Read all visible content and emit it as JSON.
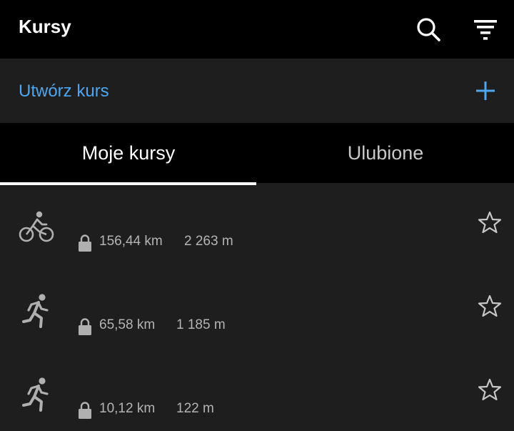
{
  "header": {
    "title": "Kursy",
    "icons": {
      "search": "search-icon",
      "filter": "filter-icon"
    }
  },
  "create": {
    "label": "Utwórz kurs",
    "icon": "plus-icon"
  },
  "tabs": [
    {
      "label": "Moje kursy",
      "active": true
    },
    {
      "label": "Ulubione",
      "active": false
    }
  ],
  "courses": [
    {
      "activity": "cycling-icon",
      "distance": "156,44 km",
      "elevation": "2 263 m",
      "locked": true,
      "favorite": false
    },
    {
      "activity": "running-icon",
      "distance": "65,58 km",
      "elevation": "1 185 m",
      "locked": true,
      "favorite": false
    },
    {
      "activity": "running-icon",
      "distance": "10,12 km",
      "elevation": "122 m",
      "locked": true,
      "favorite": false
    }
  ],
  "colors": {
    "header_bg": "#000000",
    "surface_bg": "#1e1e1e",
    "accent": "#4ea6f0",
    "text_primary": "#ffffff",
    "text_secondary": "#b4b4b4",
    "icon_gray": "#b0b0b0"
  }
}
